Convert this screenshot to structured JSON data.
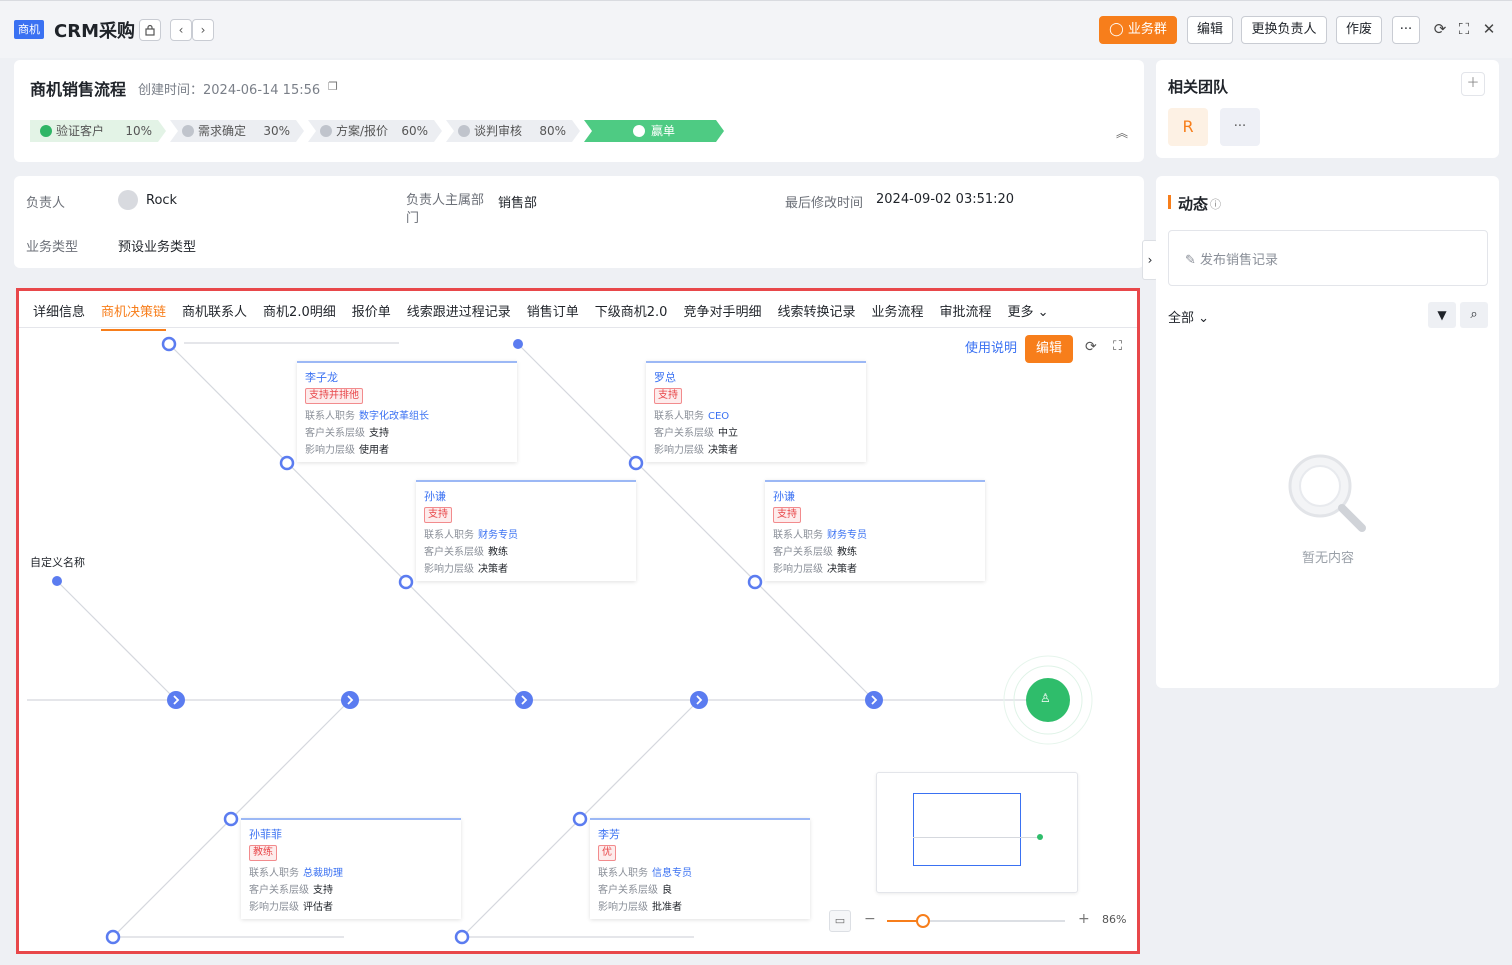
{
  "header": {
    "tag": "商机",
    "title": "CRM采购",
    "lock_icon": "lock-icon",
    "group_button": "业务群",
    "edit_button": "编辑",
    "change_owner_button": "更换负责人",
    "void_button": "作废",
    "more_button": "···"
  },
  "process": {
    "title": "商机销售流程",
    "created": "创建时间：2024-06-14 15:56",
    "stages": [
      {
        "name": "验证客户",
        "pct": "10%"
      },
      {
        "name": "需求确定",
        "pct": "30%"
      },
      {
        "name": "方案/报价",
        "pct": "60%"
      },
      {
        "name": "谈判审核",
        "pct": "80%"
      },
      {
        "name": "赢单",
        "pct": ""
      }
    ]
  },
  "info": {
    "owner_label": "负责人",
    "owner_value": "Rock",
    "dept_label": "负责人主属部门",
    "dept_value": "销售部",
    "modified_label": "最后修改时间",
    "modified_value": "2024-09-02 03:51:20",
    "type_label": "业务类型",
    "type_value": "预设业务类型"
  },
  "tabs": [
    "详细信息",
    "商机决策链",
    "商机联系人",
    "商机2.0明细",
    "报价单",
    "线索跟进过程记录",
    "销售订单",
    "下级商机2.0",
    "竞争对手明细",
    "线索转换记录",
    "业务流程",
    "审批流程",
    "更多"
  ],
  "active_tab": "商机决策链",
  "chain": {
    "usage_link": "使用说明",
    "edit_button": "编辑",
    "custom_label": "自定义名称",
    "zoom": "86%",
    "zoom_fraction": 0.2,
    "field_labels": {
      "role": "联系人职务",
      "relation": "客户关系层级",
      "influence": "影响力层级"
    },
    "nodes": [
      {
        "name": "李子龙",
        "badge": "支持并排他",
        "role": "数字化改革组长",
        "relation": "支持",
        "influence": "使用者"
      },
      {
        "name": "罗总",
        "badge": "支持",
        "role": "CEO",
        "relation": "中立",
        "influence": "决策者"
      },
      {
        "name": "孙谦",
        "badge": "支持",
        "role": "财务专员",
        "relation": "教练",
        "influence": "决策者"
      },
      {
        "name": "孙谦",
        "badge": "支持",
        "role": "财务专员",
        "relation": "教练",
        "influence": "决策者"
      },
      {
        "name": "孙菲菲",
        "badge": "教练",
        "role": "总裁助理",
        "relation": "支持",
        "influence": "评估者"
      },
      {
        "name": "李芳",
        "badge": "优",
        "role": "信息专员",
        "relation": "良",
        "influence": "批准者"
      }
    ]
  },
  "team": {
    "title": "相关团队",
    "member_initial": "R",
    "more": "···"
  },
  "feed": {
    "title": "动态",
    "post_placeholder": "发布销售记录",
    "filter": "全部",
    "empty": "暂无内容"
  },
  "colors": {
    "accent": "#f77e1b",
    "primary": "#3a71f2",
    "success": "#4ecb83",
    "highlight_border": "#e8474a"
  }
}
